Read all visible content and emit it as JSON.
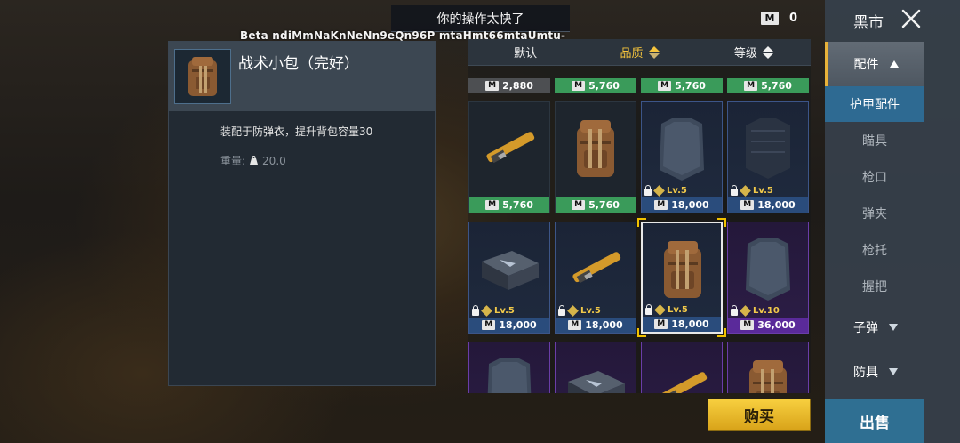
{
  "toast": {
    "text": "你的操作太快了"
  },
  "watermark": {
    "text": "Beta ndiMmNaKnNeNn9eQn96P mtaHmt66mtaUmtu-"
  },
  "currency": {
    "symbol": "M",
    "balance": "0"
  },
  "detail": {
    "title": "战术小包（完好）",
    "description": "装配于防弹衣，提升背包容量30",
    "weight_label": "重量:",
    "weight_value": "20.0",
    "thumb_icon": "tactical-pouch-icon"
  },
  "sort": {
    "tabs": [
      {
        "label": "默认",
        "active": false
      },
      {
        "label": "品质",
        "active": true
      },
      {
        "label": "等级",
        "active": false
      }
    ]
  },
  "top_prices": [
    {
      "price": "2,880",
      "color": "gray"
    },
    {
      "price": "5,760",
      "color": "green"
    },
    {
      "price": "5,760",
      "color": "green"
    },
    {
      "price": "5,760",
      "color": "green"
    }
  ],
  "grid": [
    {
      "item": "strap",
      "price": "5,760",
      "quality": "green",
      "level": ""
    },
    {
      "item": "pouch",
      "price": "5,760",
      "quality": "green",
      "level": ""
    },
    {
      "item": "plate",
      "price": "18,000",
      "quality": "blue",
      "level": "Lv.5"
    },
    {
      "item": "vest-plate",
      "price": "18,000",
      "quality": "blue",
      "level": "Lv.5"
    },
    {
      "item": "case",
      "price": "18,000",
      "quality": "blue",
      "level": "Lv.5"
    },
    {
      "item": "strap",
      "price": "18,000",
      "quality": "blue",
      "level": "Lv.5"
    },
    {
      "item": "pouch",
      "price": "18,000",
      "quality": "blue",
      "level": "Lv.5",
      "selected": true
    },
    {
      "item": "plate",
      "price": "36,000",
      "quality": "purple",
      "level": "Lv.10"
    },
    {
      "item": "plate",
      "price": "",
      "quality": "purple",
      "level": ""
    },
    {
      "item": "case",
      "price": "",
      "quality": "purple",
      "level": ""
    },
    {
      "item": "strap",
      "price": "",
      "quality": "purple",
      "level": ""
    },
    {
      "item": "pouch",
      "price": "",
      "quality": "purple",
      "level": ""
    }
  ],
  "buy_label": "购买",
  "sidebar": {
    "title": "黑市",
    "category_open": "配件",
    "sub_items": [
      "护甲配件",
      "瞄具",
      "枪口",
      "弹夹",
      "枪托",
      "握把"
    ],
    "categories_closed": [
      "子弹",
      "防具"
    ],
    "sell_label": "出售"
  },
  "colors": {
    "accent_gold": "#f5c43c",
    "green": "#3a9b5a",
    "blue": "#2a4c7c",
    "purple": "#5a2a9a",
    "selected_tab": "#2e6a92"
  }
}
